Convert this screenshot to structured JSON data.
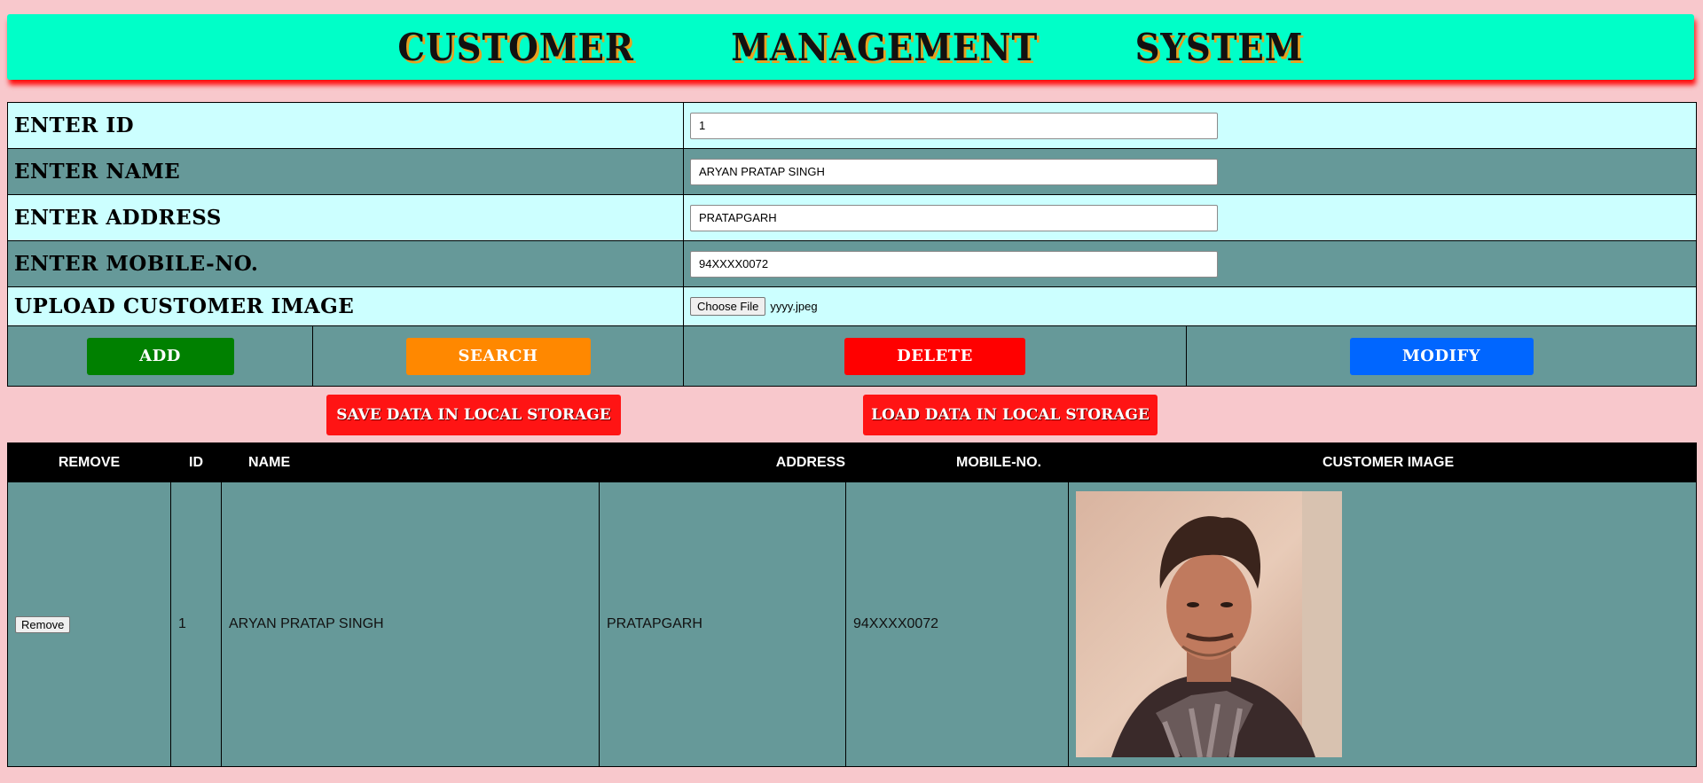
{
  "header": {
    "title": "CUSTOMER   MANAGEMENT   SYSTEM"
  },
  "form": {
    "id_label": "ENTER ID",
    "id_value": "1",
    "name_label": "ENTER NAME",
    "name_value": "ARYAN PRATAP SINGH",
    "address_label": "ENTER ADDRESS",
    "address_value": "PRATAPGARH",
    "mobile_label": "ENTER MOBILE-NO.",
    "mobile_value": "94XXXX0072",
    "image_label": "UPLOAD CUSTOMER IMAGE",
    "file_button": "Choose File",
    "file_name": "yyyy.jpeg"
  },
  "actions": {
    "add": "ADD",
    "search": "SEARCH",
    "delete": "DELETE",
    "modify": "MODIFY"
  },
  "storage": {
    "save": "SAVE DATA IN LOCAL STORAGE",
    "load": "LOAD DATA IN LOCAL STORAGE"
  },
  "table": {
    "headers": [
      "REMOVE",
      "ID",
      "NAME",
      "ADDRESS",
      "MOBILE-NO.",
      "CUSTOMER IMAGE"
    ],
    "rows": [
      {
        "remove_label": "Remove",
        "id": "1",
        "name": "ARYAN PRATAP SINGH",
        "address": "PRATAPGARH",
        "mobile": "94XXXX0072"
      }
    ]
  },
  "colors": {
    "header_bg": "#00ffc8",
    "add": "#008000",
    "search": "#ff8800",
    "delete": "#ff0000",
    "modify": "#0066ff",
    "storage": "#ff1414"
  }
}
